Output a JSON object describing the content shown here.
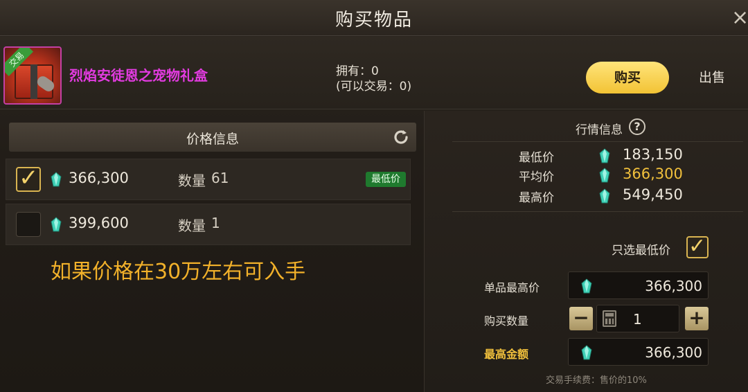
{
  "window": {
    "title": "购买物品",
    "close_icon": "×"
  },
  "item": {
    "name": "烈焰安徒恩之宠物礼盒",
    "trade_tag": "交易",
    "owned_line": "拥有：0",
    "tradable_line": "(可以交易：0)",
    "name_color": "#e23be0"
  },
  "mode_toggle": {
    "buy_label": "购买",
    "sell_label": "出售",
    "selected": "购买"
  },
  "price_panel": {
    "title": "价格信息",
    "listings": [
      {
        "checked": true,
        "price": "366,300",
        "qty_label": "数量",
        "qty": "61",
        "badge": "最低价"
      },
      {
        "checked": false,
        "price": "399,600",
        "qty_label": "数量",
        "qty": "1",
        "badge": ""
      }
    ]
  },
  "note": "如果价格在30万左右可入手",
  "market": {
    "title": "行情信息",
    "help_icon": "?",
    "min_label": "最低价",
    "min_value": "183,150",
    "avg_label": "平均价",
    "avg_value": "366,300",
    "max_label": "最高价",
    "max_value": "549,450"
  },
  "purchase": {
    "only_lowest_label": "只选最低价",
    "only_lowest_checked": true,
    "unit_max_label": "单品最高价",
    "unit_max_value": "366,300",
    "qty_label": "购买数量",
    "qty_value": "1",
    "minus": "−",
    "plus": "+",
    "total_label": "最高金额",
    "total_value": "366,300",
    "fee_note": "交易手续费：售价的10%"
  },
  "icons": {
    "currency": "gem-icon",
    "refresh": "refresh-icon",
    "check": "✓",
    "calculator": "calculator-icon"
  },
  "colors": {
    "accent_gold": "#f1c03c",
    "badge_green": "#1f7a2e",
    "note_orange": "#f2b12a"
  }
}
